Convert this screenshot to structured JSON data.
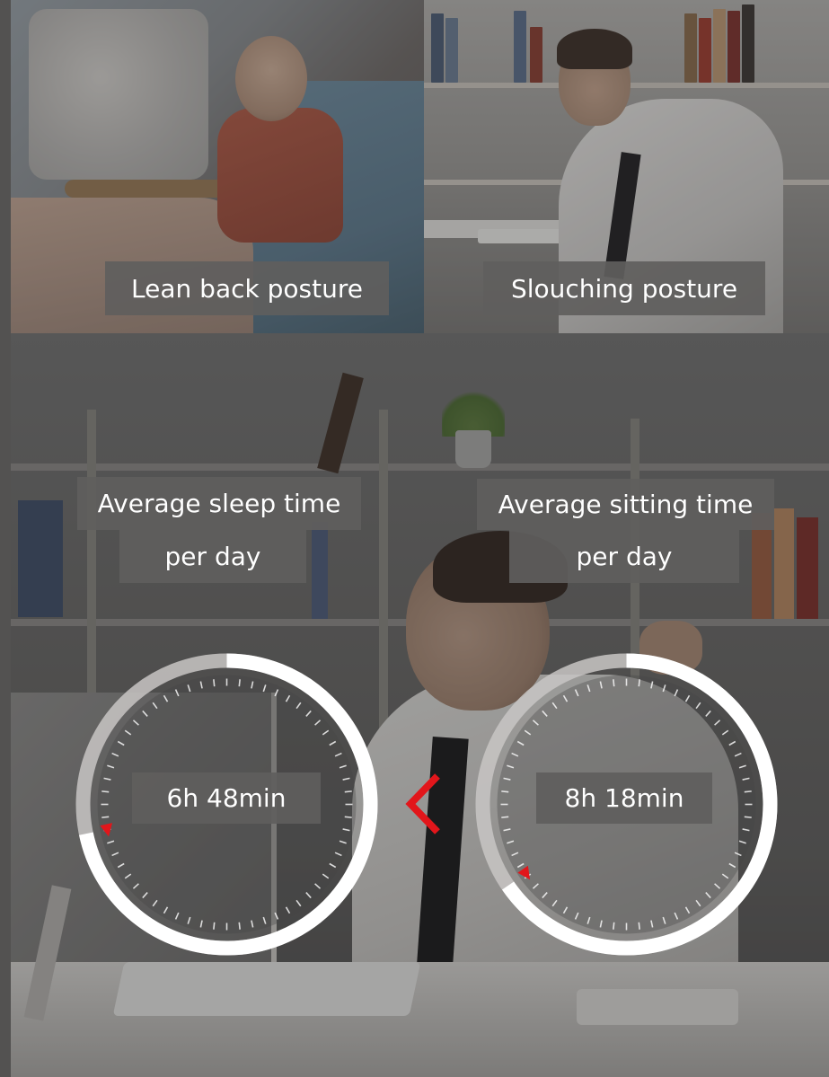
{
  "postures": {
    "lean_back": "Lean back posture",
    "slouching": "Slouching posture"
  },
  "sleep": {
    "title": "Average sleep time",
    "subtitle": "per day",
    "value": "6h 48min",
    "fraction_of_day": 0.283
  },
  "sitting": {
    "title": "Average sitting time",
    "subtitle": "per day",
    "value": "8h 18min",
    "fraction_of_day": 0.346
  },
  "colors": {
    "label_bg": "#5f5e5d",
    "label_text": "#ffffff",
    "ring_white": "#ffffff",
    "ring_gray": "#c8c6c4",
    "marker_red": "#e2161b",
    "chevron_red": "#e2161b"
  },
  "icons": {
    "comparison": "less-than-chevron-icon",
    "dial_marker": "red-triangle-marker-icon"
  }
}
